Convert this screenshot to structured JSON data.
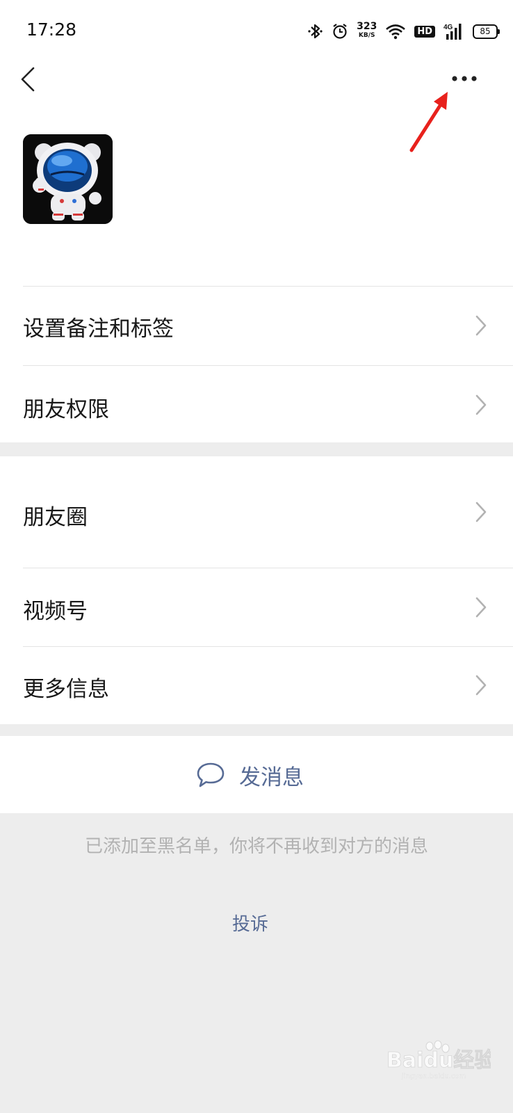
{
  "status_bar": {
    "time": "17:28",
    "network_speed": "323",
    "network_speed_unit": "KB/S",
    "hd_badge": "HD",
    "network_type": "4G",
    "battery": "85"
  },
  "header": {
    "back_icon": "chevron-left-icon",
    "more_icon": "more-dots-icon"
  },
  "profile": {
    "avatar_icon": "astronaut-avatar-icon"
  },
  "menu": {
    "remark_tags": "设置备注和标签",
    "friend_permissions": "朋友权限",
    "moments": "朋友圈",
    "channels": "视频号",
    "more_info": "更多信息"
  },
  "actions": {
    "send_message": "发消息",
    "send_icon": "chat-bubble-icon"
  },
  "notice": {
    "blacklist_text": "已添加至黑名单，你将不再收到对方的消息",
    "complain_link": "投诉"
  },
  "watermark": {
    "text": "Baidu经验",
    "subtext": "jingyan.baidu.com"
  },
  "colors": {
    "link_blue": "#576b95",
    "background": "#ededed",
    "annotation_arrow": "#e8211c"
  }
}
